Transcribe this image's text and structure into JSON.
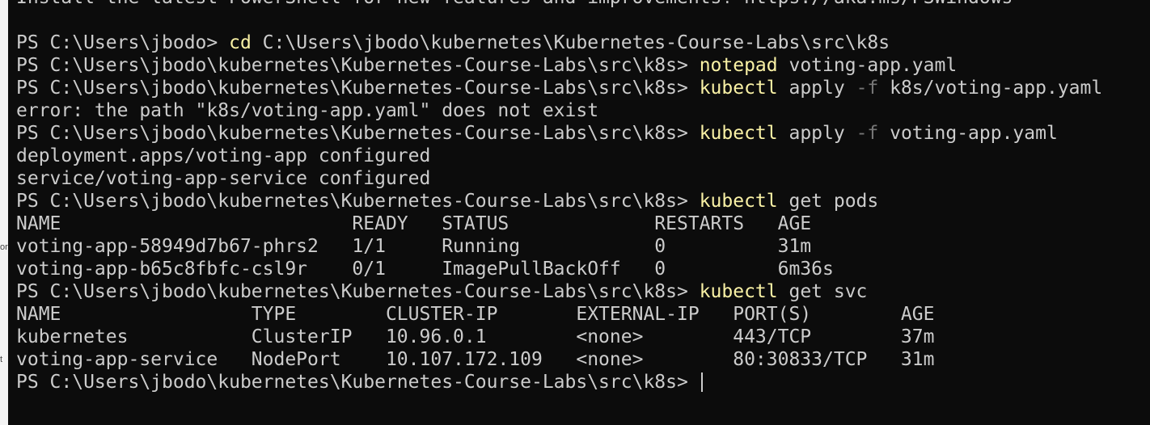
{
  "left_strip": {
    "glyphs": [
      "or",
      "t"
    ]
  },
  "terminal": {
    "lines": [
      [
        {
          "t": "Install the latest PowerShell for new features and improvements! https://aka.ms/PSWindows"
        }
      ],
      [],
      [
        {
          "t": "PS C:\\Users\\jbodo> "
        },
        {
          "t": "cd",
          "s": "cmd"
        },
        {
          "t": " C:\\Users\\jbodo\\kubernetes\\Kubernetes-Course-Labs\\src\\k8s"
        }
      ],
      [
        {
          "t": "PS C:\\Users\\jbodo\\kubernetes\\Kubernetes-Course-Labs\\src\\k8s> "
        },
        {
          "t": "notepad",
          "s": "cmd"
        },
        {
          "t": " voting-app.yaml"
        }
      ],
      [
        {
          "t": "PS C:\\Users\\jbodo\\kubernetes\\Kubernetes-Course-Labs\\src\\k8s> "
        },
        {
          "t": "kubectl",
          "s": "cmd"
        },
        {
          "t": " apply "
        },
        {
          "t": "-f",
          "s": "flag"
        },
        {
          "t": " k8s/voting-app.yaml"
        }
      ],
      [
        {
          "t": "error: the path \"k8s/voting-app.yaml\" does not exist"
        }
      ],
      [
        {
          "t": "PS C:\\Users\\jbodo\\kubernetes\\Kubernetes-Course-Labs\\src\\k8s> "
        },
        {
          "t": "kubectl",
          "s": "cmd"
        },
        {
          "t": " apply "
        },
        {
          "t": "-f",
          "s": "flag"
        },
        {
          "t": " voting-app.yaml"
        }
      ],
      [
        {
          "t": "deployment.apps/voting-app configured"
        }
      ],
      [
        {
          "t": "service/voting-app-service configured"
        }
      ],
      [
        {
          "t": "PS C:\\Users\\jbodo\\kubernetes\\Kubernetes-Course-Labs\\src\\k8s> "
        },
        {
          "t": "kubectl",
          "s": "cmd"
        },
        {
          "t": " get pods"
        }
      ],
      [
        {
          "t": "NAME                          READY   STATUS             RESTARTS   AGE"
        }
      ],
      [
        {
          "t": "voting-app-58949d7b67-phrs2   1/1     Running            0          31m"
        }
      ],
      [
        {
          "t": "voting-app-b65c8fbfc-csl9r    0/1     ImagePullBackOff   0          6m36s"
        }
      ],
      [
        {
          "t": "PS C:\\Users\\jbodo\\kubernetes\\Kubernetes-Course-Labs\\src\\k8s> "
        },
        {
          "t": "kubectl",
          "s": "cmd"
        },
        {
          "t": " get svc"
        }
      ],
      [
        {
          "t": "NAME                 TYPE        CLUSTER-IP       EXTERNAL-IP   PORT(S)        AGE"
        }
      ],
      [
        {
          "t": "kubernetes           ClusterIP   10.96.0.1        <none>        443/TCP        37m"
        }
      ],
      [
        {
          "t": "voting-app-service   NodePort    10.107.172.109   <none>        80:30833/TCP   31m"
        }
      ],
      [
        {
          "t": "PS C:\\Users\\jbodo\\kubernetes\\Kubernetes-Course-Labs\\src\\k8s> "
        }
      ]
    ],
    "cursor_line": 17
  },
  "colors": {
    "background": "#0c0c0c",
    "foreground": "#cccccc",
    "command": "#f9f1a5",
    "flag": "#767676"
  }
}
